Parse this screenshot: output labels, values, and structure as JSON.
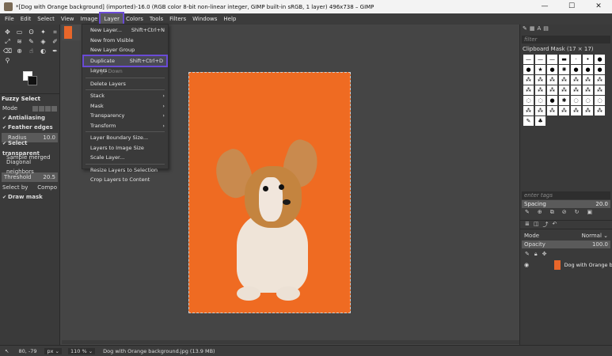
{
  "window": {
    "title": "*[Dog with Orange background] (imported)-16.0 (RGB color 8-bit non-linear integer, GIMP built-in sRGB, 1 layer) 496x738 – GIMP",
    "minimize": "—",
    "maximize": "☐",
    "close": "✕"
  },
  "menubar": [
    "File",
    "Edit",
    "Select",
    "View",
    "Image",
    "Layer",
    "Colors",
    "Tools",
    "Filters",
    "Windows",
    "Help"
  ],
  "layer_menu": [
    {
      "label": "New Layer...",
      "shortcut": "Shift+Ctrl+N"
    },
    {
      "label": "New from Visible",
      "shortcut": ""
    },
    {
      "label": "New Layer Group",
      "shortcut": ""
    },
    {
      "label": "Duplicate Layers",
      "shortcut": "Shift+Ctrl+D"
    },
    {
      "label": "Merge Down",
      "shortcut": ""
    },
    {
      "label": "Delete Layers",
      "shortcut": ""
    },
    {
      "label": "Stack",
      "shortcut": "›"
    },
    {
      "label": "Mask",
      "shortcut": "›"
    },
    {
      "label": "Transparency",
      "shortcut": "›"
    },
    {
      "label": "Transform",
      "shortcut": "›"
    },
    {
      "label": "Layer Boundary Size...",
      "shortcut": ""
    },
    {
      "label": "Layers to Image Size",
      "shortcut": ""
    },
    {
      "label": "Scale Layer...",
      "shortcut": ""
    },
    {
      "label": "Resize Layers to Selection",
      "shortcut": ""
    },
    {
      "label": "Crop Layers to Content",
      "shortcut": ""
    }
  ],
  "tool_options": {
    "title": "Fuzzy Select",
    "mode_label": "Mode",
    "antialiasing": "Antialiasing",
    "feather_edges": "Feather edges",
    "radius_label": "Radius",
    "radius_value": "10.0",
    "select_transparent": "Select transparent",
    "sample_merged": "Sample merged",
    "diagonal_neighbors": "Diagonal neighbors",
    "threshold_label": "Threshold",
    "threshold_value": "20.5",
    "select_by_label": "Select by",
    "select_by_value": "Compo",
    "draw_mask": "Draw mask"
  },
  "right_panel": {
    "filter_placeholder": "filter",
    "brush_title": "Clipboard Mask (17 × 17)",
    "tags_placeholder": "enter tags",
    "spacing_label": "Spacing",
    "spacing_value": "20.0",
    "mode_label": "Mode",
    "mode_value": "Normal ⌄",
    "opacity_label": "Opacity",
    "opacity_value": "100.0",
    "layer_name": "Dog with Orange ba"
  },
  "status": {
    "coords": "80, -79",
    "unit": "px ⌄",
    "zoom": "110 % ⌄",
    "file_info": "Dog with Orange background.jpg (13.9 MB)"
  },
  "colors": {
    "accent": "#6a4bd6",
    "image_bg": "#ef6b22"
  }
}
